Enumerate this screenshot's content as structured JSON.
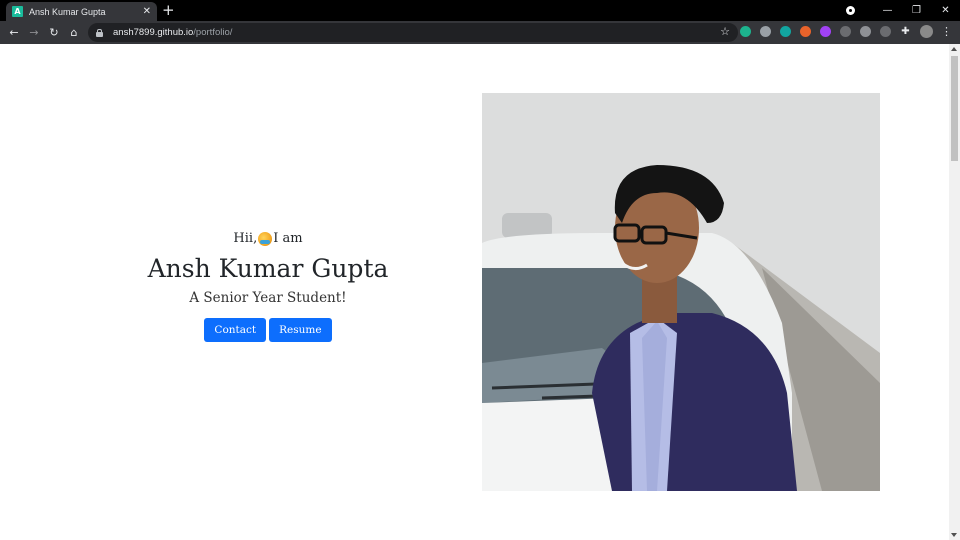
{
  "browser": {
    "tab_title": "Ansh Kumar Gupta",
    "favicon_letter": "A",
    "url_host": "ansh7899.github.io",
    "url_path": "/portfolio/"
  },
  "hero": {
    "greeting_before": "Hii,",
    "greeting_after": "I am",
    "name": "Ansh Kumar Gupta",
    "subtitle": "A Senior Year Student!",
    "buttons": [
      {
        "label": "Contact"
      },
      {
        "label": "Resume"
      }
    ]
  },
  "colors": {
    "primary_button": "#0d6efd",
    "text": "#212529",
    "chrome_dark": "#35363a"
  },
  "icons": {
    "wave": "waving-hand-icon",
    "back": "back-arrow-icon",
    "forward": "forward-arrow-icon",
    "reload": "reload-icon",
    "home": "home-icon",
    "lock": "lock-icon",
    "star": "bookmark-star-icon"
  }
}
